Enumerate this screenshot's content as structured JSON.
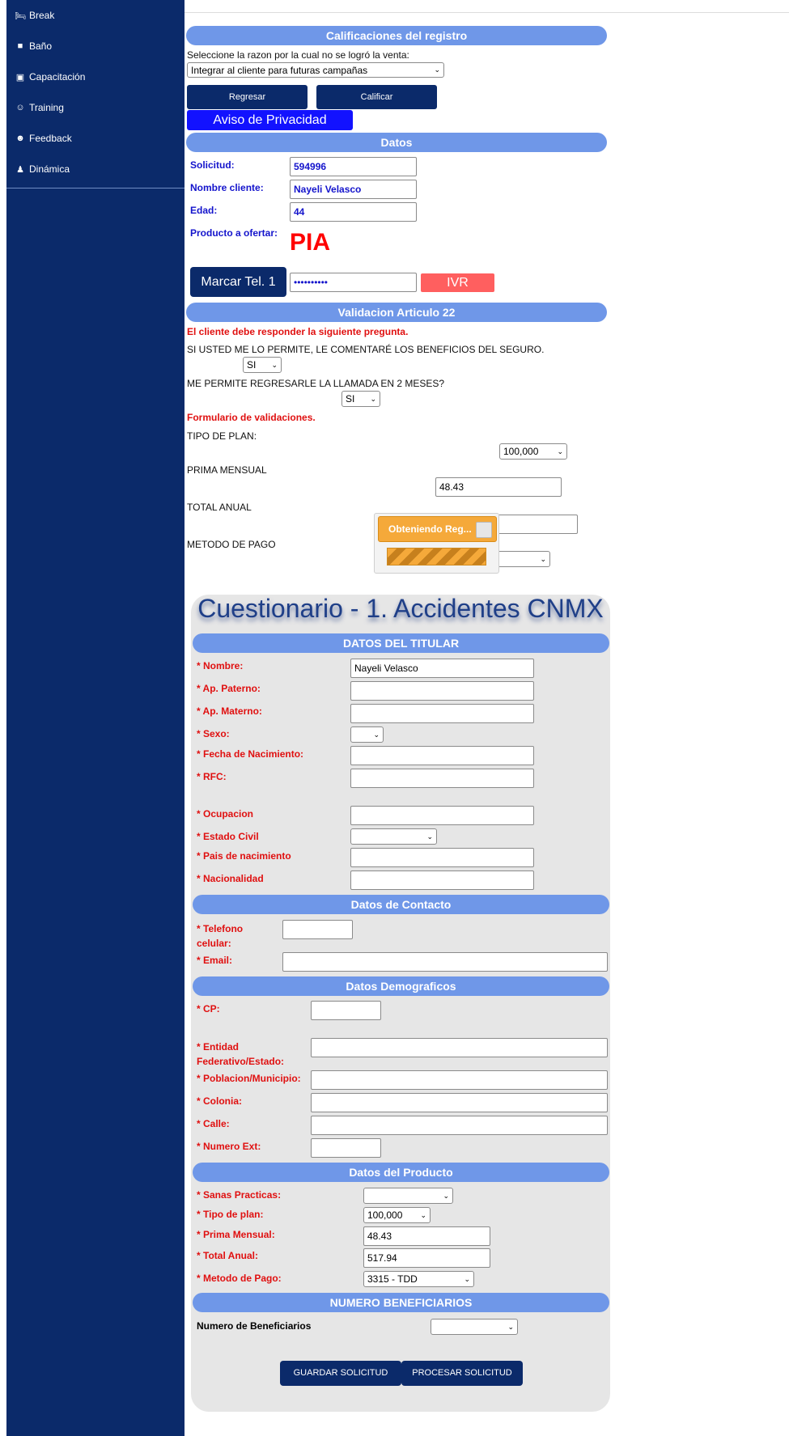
{
  "sidebar": {
    "items": [
      {
        "label": "Break",
        "icon": "bed-icon"
      },
      {
        "label": "Baño",
        "icon": "toilet-icon"
      },
      {
        "label": "Capacitación",
        "icon": "chalkboard-icon"
      },
      {
        "label": "Training",
        "icon": "people-icon"
      },
      {
        "label": "Feedback",
        "icon": "people-talk-icon"
      },
      {
        "label": "Dinámica",
        "icon": "people-group-icon"
      }
    ]
  },
  "calificaciones": {
    "title": "Calificaciones del registro",
    "prompt": "Seleccione la razon por la cual no se logró la venta:",
    "reason_selected": "Integrar al cliente para futuras campañas",
    "regresar_label": "Regresar",
    "calificar_label": "Calificar",
    "privacidad_label": "Aviso de Privacidad"
  },
  "datos": {
    "title": "Datos",
    "solicitud_label": "Solicitud:",
    "solicitud_value": "594996",
    "nombre_label": "Nombre cliente:",
    "nombre_value": "Nayeli Velasco",
    "edad_label": "Edad:",
    "edad_value": "44",
    "producto_label": "Producto a ofertar:",
    "producto_value": "PIA",
    "marcar_label": "Marcar Tel. 1",
    "phone_masked": "••••••••••",
    "ivr_label": "IVR"
  },
  "validacion": {
    "title": "Validacion Articulo 22",
    "warning": "El cliente debe responder la siguiente pregunta.",
    "q1": "SI USTED ME LO PERMITE, LE COMENTARÉ LOS BENEFICIOS DEL SEGURO.",
    "q1_value": "SI",
    "q2": "ME PERMITE REGRESARLE LA LLAMADA EN 2 MESES?",
    "q2_value": "SI",
    "form_title": "Formulario de validaciones.",
    "tipo_plan_label": "TIPO DE PLAN:",
    "tipo_plan_value": "100,000",
    "prima_label": "PRIMA MENSUAL",
    "prima_value": "48.43",
    "total_label": "TOTAL ANUAL",
    "metodo_label": "METODO DE PAGO"
  },
  "overlay": {
    "label": "Obteniendo Reg...",
    "progress": 1.0
  },
  "cuestionario": {
    "title": "Cuestionario - 1. Accidentes CNMX",
    "titular": {
      "title": "DATOS DEL TITULAR",
      "nombre_label": "* Nombre:",
      "nombre_value": "Nayeli Velasco",
      "paterno_label": "* Ap. Paterno:",
      "materno_label": "* Ap. Materno:",
      "sexo_label": "* Sexo:",
      "fecha_label": "* Fecha de Nacimiento:",
      "rfc_label": "* RFC:",
      "ocupacion_label": "* Ocupacion",
      "civil_label": "* Estado Civil",
      "pais_label": "* Pais de nacimiento",
      "nacionalidad_label": "* Nacionalidad"
    },
    "contacto": {
      "title": "Datos de Contacto",
      "telefono_label": "* Telefono celular:",
      "email_label": "* Email:"
    },
    "demograficos": {
      "title": "Datos Demograficos",
      "cp_label": "* CP:",
      "entidad_label": "* Entidad Federativo/Estado:",
      "poblacion_label": "* Poblacion/Municipio:",
      "colonia_label": "* Colonia:",
      "calle_label": "* Calle:",
      "numero_label": "* Numero Ext:"
    },
    "producto": {
      "title": "Datos del Producto",
      "sanas_label": "* Sanas Practicas:",
      "tipo_label": "* Tipo de plan:",
      "tipo_value": "100,000",
      "prima_label": "* Prima Mensual:",
      "prima_value": "48.43",
      "total_label": "* Total Anual:",
      "total_value": "517.94",
      "metodo_label": "* Metodo de Pago:",
      "metodo_value": "3315 - TDD"
    },
    "beneficiarios": {
      "title": "NUMERO BENEFICIARIOS",
      "label": "Numero de Beneficiarios"
    },
    "guardar_label": "GUARDAR SOLICITUD",
    "procesar_label": "PROCESAR SOLICITUD"
  }
}
